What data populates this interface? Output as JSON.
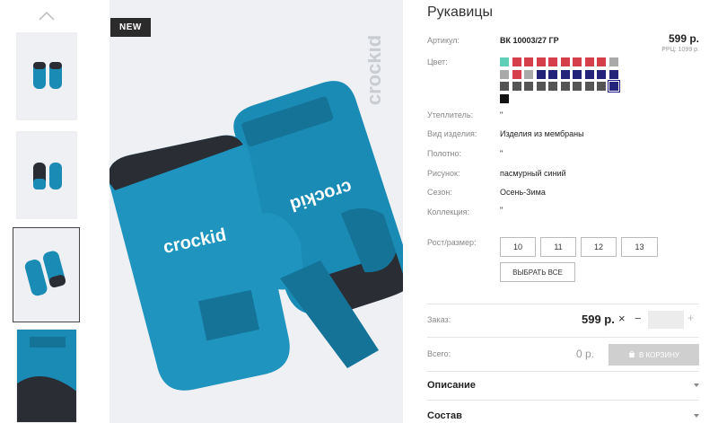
{
  "product": {
    "title": "Рукавицы",
    "badge": "NEW",
    "brand": "crockid",
    "price": "599 р.",
    "rrp": "РРЦ: 1099 р."
  },
  "attributes": [
    {
      "label": "Артикул:",
      "value": "ВК 10003/27 ГР"
    },
    {
      "label": "Цвет:",
      "value": ""
    },
    {
      "label": "Утеплитель:",
      "value": "\""
    },
    {
      "label": "Вид изделия:",
      "value": "Изделия из мембраны"
    },
    {
      "label": "Полотно:",
      "value": "\""
    },
    {
      "label": "Рисунок:",
      "value": "пасмурный синий"
    },
    {
      "label": "Сезон:",
      "value": "Осень-Зима"
    },
    {
      "label": "Коллекция:",
      "value": "\""
    },
    {
      "label": "Рост/размер:",
      "value": ""
    }
  ],
  "colors": {
    "swatches": [
      "#5fcfb8",
      "#d43f4a",
      "#d43f4a",
      "#d43f4a",
      "#d43f4a",
      "#d43f4a",
      "#d43f4a",
      "#d43f4a",
      "#d43f4a",
      "#a9a9a9",
      "#a9a9a9",
      "#d43f4a",
      "#a9a9a9",
      "#23237a",
      "#23237a",
      "#23237a",
      "#23237a",
      "#23237a",
      "#23237a",
      "#23237a",
      "#555555",
      "#555555",
      "#555555",
      "#555555",
      "#555555",
      "#555555",
      "#555555",
      "#555555",
      "#555555",
      "#23237a",
      "#111111"
    ],
    "selected_index": 29
  },
  "sizes": [
    "10",
    "11",
    "12",
    "13"
  ],
  "select_all": "ВЫБРАТЬ ВСЕ",
  "order": {
    "label": "Заказ:",
    "price": "599 р.",
    "times": "×",
    "minus": "−",
    "plus": "+",
    "quantity": ""
  },
  "total": {
    "label": "Всего:",
    "value": "0 р.",
    "cart_button": "В КОРЗИНУ"
  },
  "sections": [
    "Описание",
    "Состав"
  ],
  "theme": {
    "mitten_blue": "#1a8bb4",
    "mitten_dark": "#2a2d33",
    "bg_gray": "#eef0f3"
  }
}
